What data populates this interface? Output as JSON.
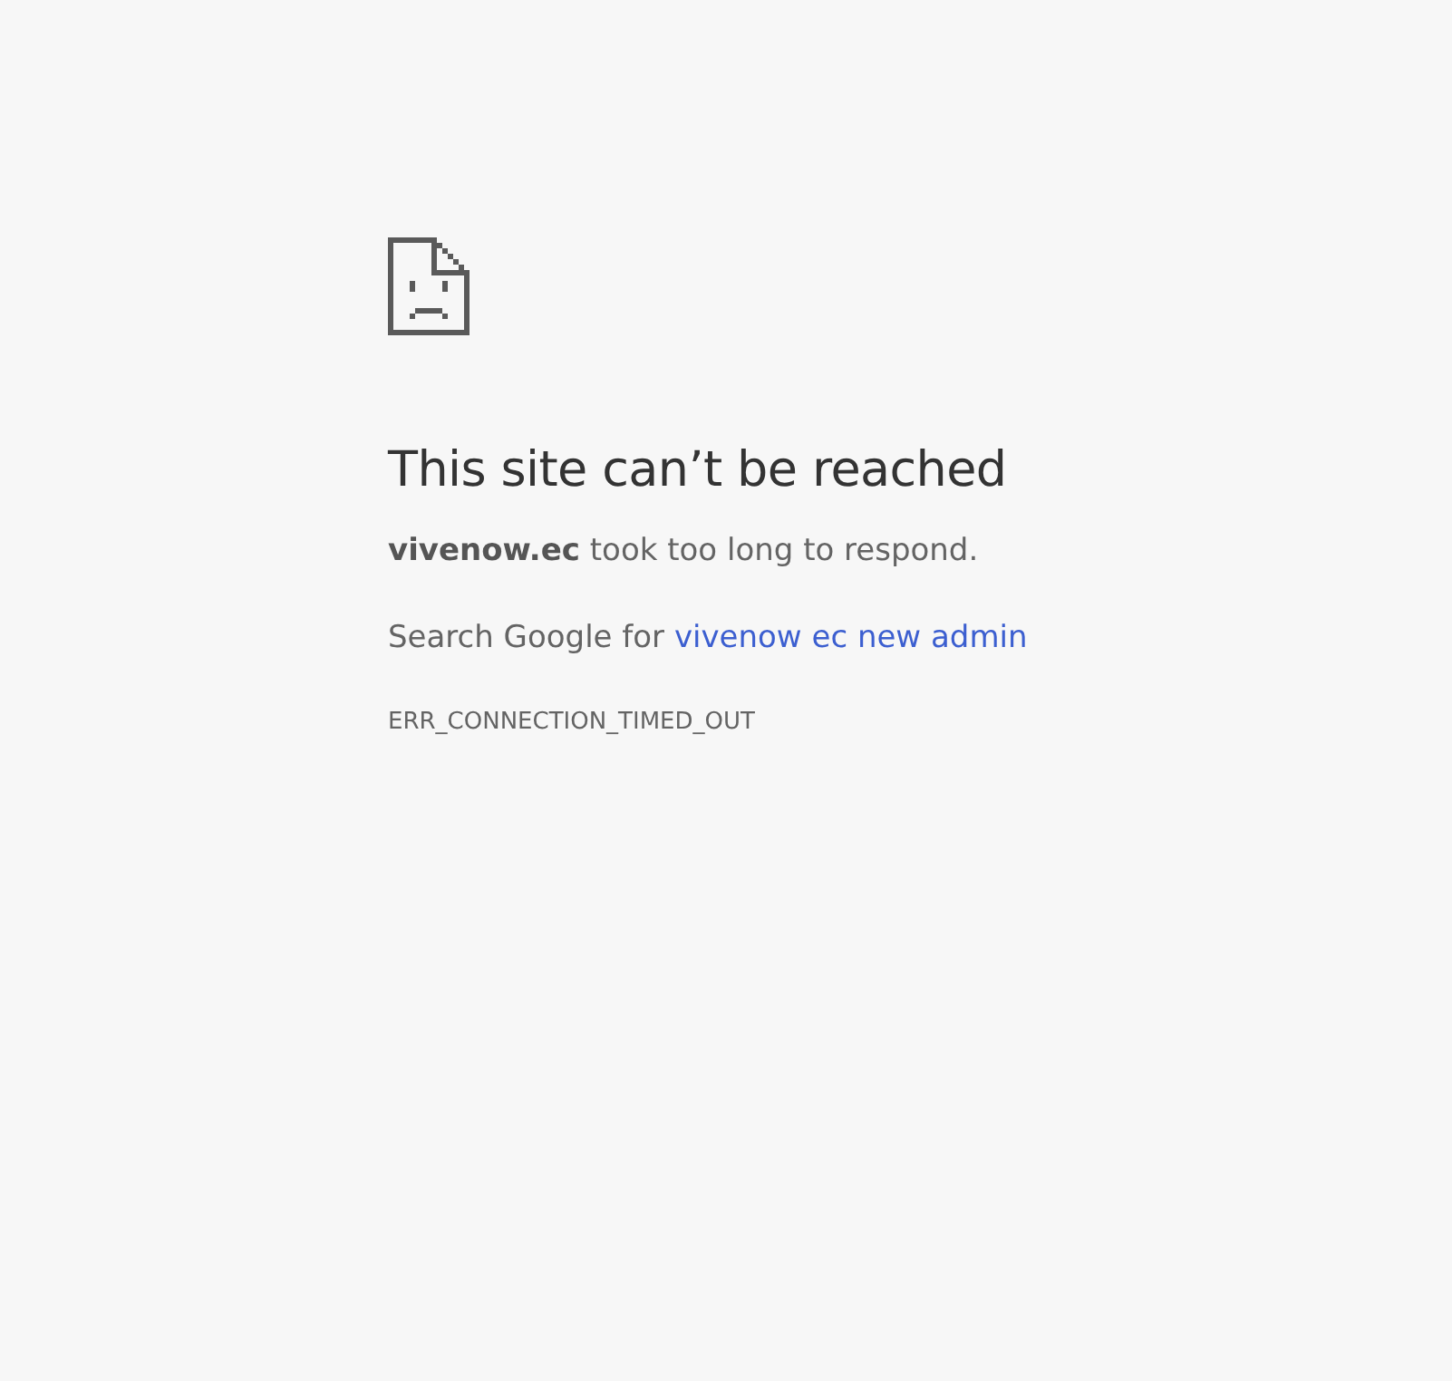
{
  "heading": "This site can’t be reached",
  "message": "**vivenow.ec** took too long to respond.",
  "suggestion": {
    "prefix": "Search Google for",
    "link": "vivenow ec new admin"
  },
  "error_code": "ERR_CONNECTION_TIMED_OUT"
}
